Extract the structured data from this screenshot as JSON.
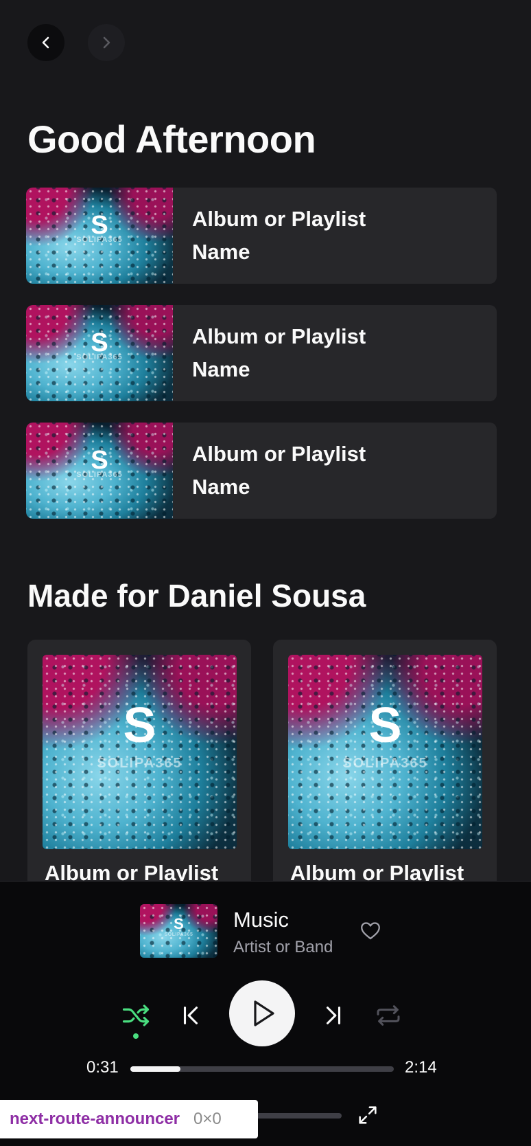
{
  "greeting": "Good Afternoon",
  "quick_picks": [
    {
      "label": "Album or Playlist Name",
      "cover_mark": "S",
      "cover_word": "SOLIPA365"
    },
    {
      "label": "Album or Playlist Name",
      "cover_mark": "S",
      "cover_word": "SOLIPA365"
    },
    {
      "label": "Album or Playlist Name",
      "cover_mark": "S",
      "cover_word": "SOLIPA365"
    }
  ],
  "made_for": {
    "title": "Made for Daniel Sousa",
    "cards": [
      {
        "label": "Album or Playlist",
        "cover_mark": "S",
        "cover_word": "SOLIPA365"
      },
      {
        "label": "Album or Playlist",
        "cover_mark": "S",
        "cover_word": "SOLIPA365"
      }
    ]
  },
  "player": {
    "track_title": "Music",
    "artist": "Artist or Band",
    "cover_mark": "S",
    "cover_word": "SOLIPA365",
    "current_time": "0:31",
    "duration": "2:14",
    "progress_fraction": 0.19,
    "volume_fraction": 0.26,
    "shuffle_active": true
  },
  "icons": {
    "back": "chevron-left-icon",
    "forward": "chevron-right-icon",
    "like": "heart-icon",
    "shuffle": "shuffle-icon",
    "previous": "skip-back-icon",
    "play": "play-icon",
    "next": "skip-forward-icon",
    "repeat": "repeat-icon",
    "fullscreen": "expand-icon"
  },
  "colors": {
    "background": "#18181b",
    "surface": "#27272a",
    "player_bg": "#09090b",
    "accent_green": "#4ade80",
    "text_muted": "#a1a1aa"
  },
  "dev_overlay": {
    "name": "next-route-announcer",
    "dimensions": "0×0"
  }
}
